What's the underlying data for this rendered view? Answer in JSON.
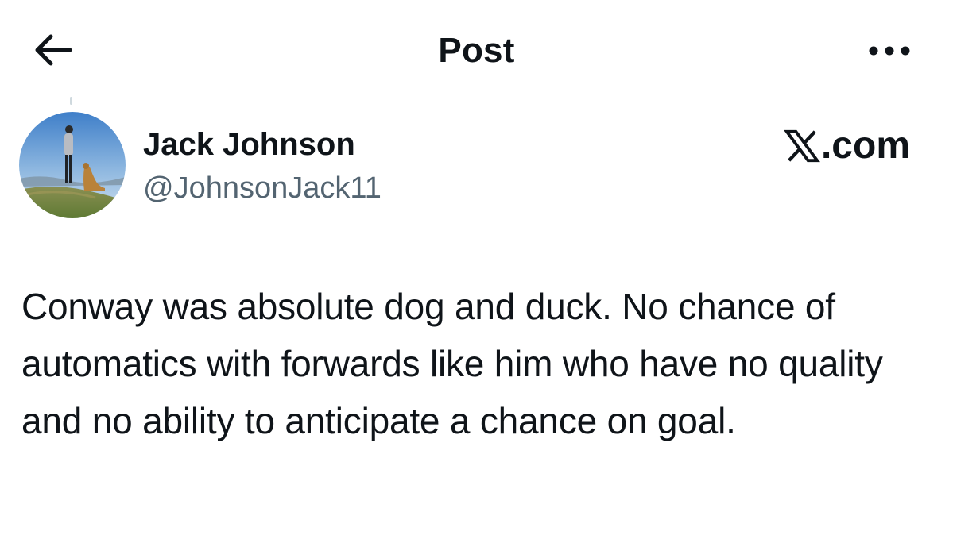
{
  "header": {
    "title": "Post",
    "back_icon": "arrow-left-icon",
    "more_icon": "more-horizontal-icon"
  },
  "author": {
    "display_name": "Jack Johnson",
    "handle": "@JohnsonJack11",
    "avatar_icon": "profile-photo"
  },
  "watermark": {
    "text": ".com",
    "logo_icon": "x-logo-icon"
  },
  "post": {
    "text": "Conway was absolute dog and duck. No chance of automatics with forwards like him who have no quality and no ability to anticipate a chance on goal."
  },
  "colors": {
    "text_primary": "#0f1419",
    "text_secondary": "#536471",
    "background": "#ffffff"
  }
}
